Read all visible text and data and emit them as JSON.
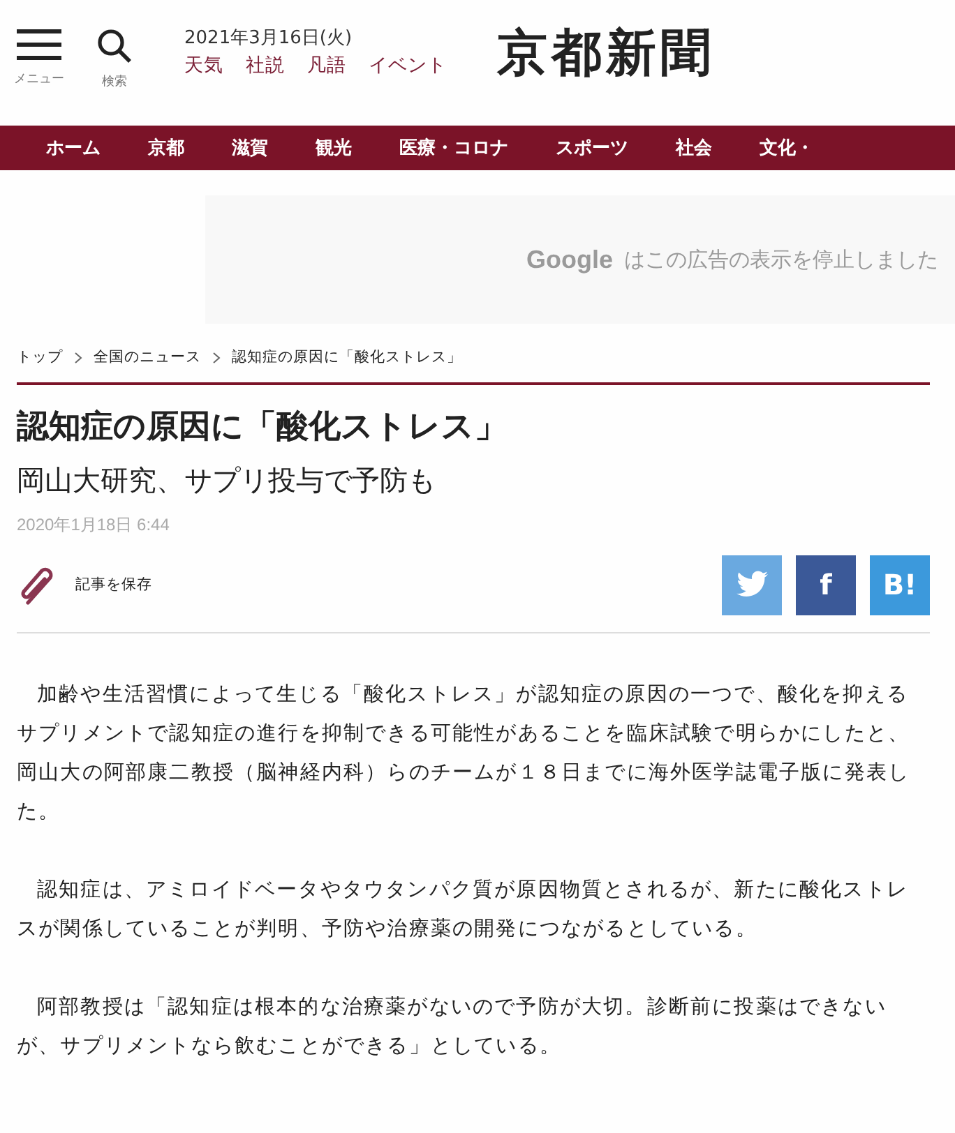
{
  "header": {
    "menu_label": "メニュー",
    "search_label": "検索",
    "date": "2021年3月16日(火)",
    "links": [
      "天気",
      "社説",
      "凡語",
      "イベント"
    ],
    "logo": "京都新聞"
  },
  "nav": [
    "ホーム",
    "京都",
    "滋賀",
    "観光",
    "医療・コロナ",
    "スポーツ",
    "社会",
    "文化・"
  ],
  "ad": {
    "brand": "Google",
    "message": "はこの広告の表示を停止しました"
  },
  "breadcrumb": [
    "トップ",
    "全国のニュース",
    "認知症の原因に「酸化ストレス」"
  ],
  "article": {
    "title": "認知症の原因に「酸化ストレス」",
    "subtitle": "岡山大研究、サプリ投与で予防も",
    "date": "2020年1月18日 6:44",
    "save_label": "記事を保存",
    "share": [
      {
        "kind": "twitter"
      },
      {
        "kind": "facebook",
        "label": "f"
      },
      {
        "kind": "hatena",
        "label": "B!"
      }
    ],
    "paragraphs": [
      "加齢や生活習慣によって生じる「酸化ストレス」が認知症の原因の一つで、酸化を抑えるサプリメントで認知症の進行を抑制できる可能性があることを臨床試験で明らかにしたと、岡山大の阿部康二教授（脳神経内科）らのチームが１８日までに海外医学誌電子版に発表した。",
      "認知症は、アミロイドベータやタウタンパク質が原因物質とされるが、新たに酸化ストレスが関係していることが判明、予防や治療薬の開発につながるとしている。",
      "阿部教授は「認知症は根本的な治療薬がないので予防が大切。診断前に投薬はできないが、サプリメントなら飲むことができる」としている。"
    ]
  }
}
